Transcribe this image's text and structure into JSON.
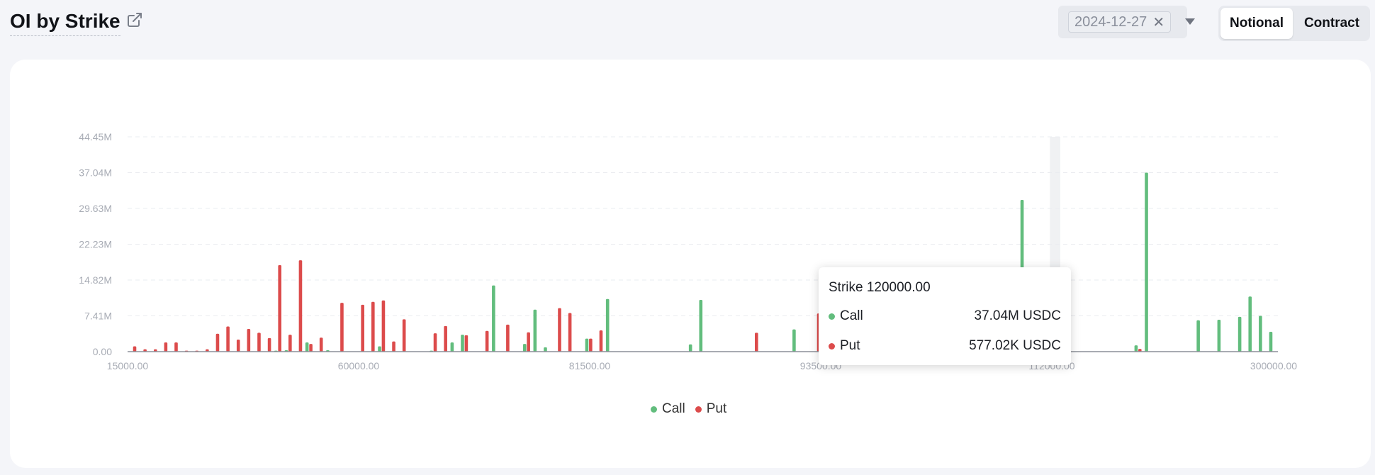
{
  "header": {
    "title": "OI by Strike",
    "open_icon": "external-link-icon"
  },
  "filters": {
    "date_value": "2024-12-27",
    "clear_icon": "close-icon",
    "dropdown_icon": "caret-down-icon"
  },
  "toggle": {
    "options": [
      "Notional",
      "Contract"
    ],
    "active": "Notional"
  },
  "tooltip": {
    "title": "Strike 120000.00",
    "rows": [
      {
        "name": "Call",
        "value": "37.04M USDC"
      },
      {
        "name": "Put",
        "value": "577.02K USDC"
      }
    ]
  },
  "colors": {
    "call": "#62bd7d",
    "put": "#dc4b4b",
    "grid": "#eaecf0",
    "axis": "#a8acb5"
  },
  "chart_data": {
    "type": "bar",
    "y_ticks": [
      "0.00",
      "7.41M",
      "14.82M",
      "22.23M",
      "29.63M",
      "37.04M",
      "44.45M"
    ],
    "ylim": [
      0,
      44.45
    ],
    "y_unit": "M",
    "x_tick_labels": [
      "15000.00",
      "60000.00",
      "81500.00",
      "93500.00",
      "112000.00",
      "300000.00"
    ],
    "highlight_index": 89,
    "legend": [
      "Call",
      "Put"
    ],
    "series": [
      {
        "name": "Call",
        "values": [
          0,
          0,
          0,
          0,
          0,
          0,
          0,
          0,
          0,
          0,
          0,
          0,
          0,
          0,
          0.2,
          0.3,
          0,
          1.9,
          0,
          0.3,
          0,
          0,
          0,
          0,
          1.1,
          0,
          0,
          0,
          0,
          0.2,
          0,
          1.9,
          3.5,
          0,
          0,
          13.7,
          0,
          0,
          1.6,
          8.7,
          0.9,
          0,
          0,
          0,
          2.7,
          0,
          10.9,
          0,
          0,
          0,
          0,
          0,
          0,
          0,
          1.5,
          10.7,
          0,
          0,
          0,
          0,
          0,
          0,
          0,
          0,
          4.6,
          0,
          0,
          0,
          0,
          12.9,
          0,
          0,
          0,
          0,
          0,
          1.6,
          0,
          0,
          0,
          0,
          0,
          0,
          0,
          0,
          0,
          0,
          31.4,
          0,
          0,
          0,
          0,
          0,
          0,
          0,
          0,
          0,
          0,
          1.3,
          37.04,
          0,
          0,
          0,
          0,
          6.5,
          0,
          6.6,
          0,
          7.2,
          11.4,
          7.4,
          4.1
        ]
      },
      {
        "name": "Put",
        "values": [
          1.1,
          0.5,
          0.5,
          1.9,
          1.9,
          0.2,
          0.2,
          0.5,
          3.7,
          5.2,
          2.5,
          4.7,
          3.9,
          2.8,
          17.9,
          3.5,
          18.9,
          1.6,
          2.9,
          0,
          10.1,
          0,
          9.7,
          10.3,
          10.6,
          2.1,
          6.7,
          0,
          0,
          3.8,
          5.3,
          0,
          3.4,
          0,
          4.3,
          0,
          5.6,
          0,
          4.0,
          0,
          0,
          9.0,
          8.0,
          0,
          2.7,
          4.4,
          0,
          0,
          0,
          0,
          0,
          0,
          0,
          0,
          0,
          0,
          0,
          0,
          0,
          0,
          3.9,
          0,
          0,
          0,
          0,
          0,
          7.9,
          0,
          0,
          0,
          0,
          0,
          6.3,
          0,
          0,
          0,
          0,
          0,
          0,
          0,
          0,
          0,
          0,
          0,
          0,
          0,
          0,
          0,
          0,
          0,
          0,
          0,
          0,
          0,
          0,
          0,
          0,
          0.577,
          0,
          0,
          0,
          0,
          0,
          0,
          0,
          0,
          0,
          0,
          0,
          0
        ]
      }
    ]
  }
}
